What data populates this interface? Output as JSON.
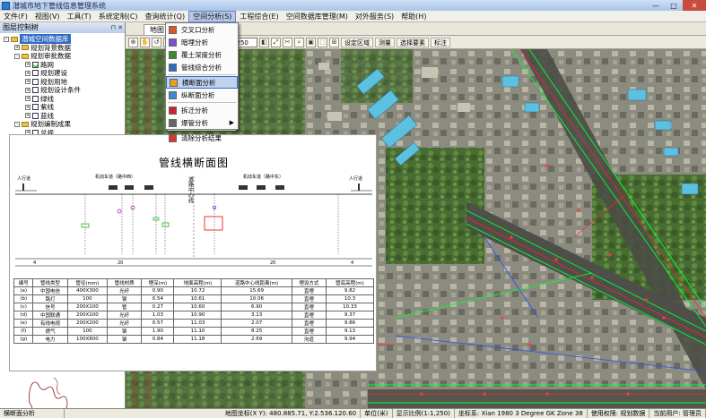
{
  "window": {
    "title": "潜城市地下管线信息管理系统",
    "min": "—",
    "max": "□",
    "close": "✕"
  },
  "menu": [
    "文件(F)",
    "视图(V)",
    "工具(T)",
    "系统定制(C)",
    "查询统计(Q)",
    "空间分析(S)",
    "工程综合(E)",
    "空间数据库管理(M)",
    "对外服务(S)",
    "帮助(H)"
  ],
  "menu_active_index": 5,
  "left_panel": {
    "title": "图层控制树",
    "tree": [
      {
        "indent": 0,
        "box": "-",
        "label": "潜城空间数据库",
        "selected": true,
        "kind": "folder"
      },
      {
        "indent": 1,
        "box": "+",
        "label": "规划背景数据",
        "kind": "folder"
      },
      {
        "indent": 1,
        "box": "-",
        "label": "规划审批数据",
        "kind": "folder"
      },
      {
        "indent": 2,
        "box": "+",
        "label": "路网",
        "checked": true
      },
      {
        "indent": 2,
        "box": "+",
        "label": "规划建设",
        "checked": false
      },
      {
        "indent": 2,
        "box": "+",
        "label": "规划用地",
        "checked": false
      },
      {
        "indent": 2,
        "box": "+",
        "label": "规划设计条件",
        "checked": false
      },
      {
        "indent": 2,
        "box": "+",
        "label": "绿线",
        "checked": false
      },
      {
        "indent": 2,
        "box": "+",
        "label": "紫线",
        "checked": false
      },
      {
        "indent": 2,
        "box": "+",
        "label": "蓝线",
        "checked": false
      },
      {
        "indent": 1,
        "box": "-",
        "label": "规划编制成果",
        "kind": "folder"
      },
      {
        "indent": 2,
        "box": "+",
        "label": "总规",
        "checked": false
      },
      {
        "indent": 2,
        "box": "+",
        "label": "控规",
        "checked": false
      }
    ]
  },
  "tab": {
    "label": "地图"
  },
  "toolbar": {
    "scale": "1:1,250",
    "buttons": [
      "设定区域",
      "测量",
      "选择要素",
      "标注"
    ]
  },
  "dropdown": {
    "items": [
      {
        "label": "交叉口分析"
      },
      {
        "label": "暗埋分析"
      },
      {
        "label": "覆土深度分析"
      },
      {
        "label": "管线综合分析"
      },
      {
        "sep": true
      },
      {
        "label": "横断面分析",
        "highlight": true
      },
      {
        "label": "纵断面分析"
      },
      {
        "sep": true
      },
      {
        "label": "拆迁分析"
      },
      {
        "label": "爆管分析",
        "submenu": true
      },
      {
        "sep": true
      },
      {
        "label": "清除分析结果"
      }
    ]
  },
  "cross_section": {
    "title": "管线横断面图",
    "labels": {
      "left_sidewalk": "人行道",
      "left_lane": "机动车道（路中西）",
      "center": "道路中心线",
      "right_lane": "机动车道（路中东）",
      "right_sidewalk": "人行道",
      "dim_left": "4",
      "dim_mid_left": "20",
      "dim_mid_right": "20",
      "dim_right": "4"
    },
    "pipe_tags": [
      "a",
      "b",
      "c",
      "d",
      "e",
      "f",
      "g"
    ],
    "table_headers": [
      "编号",
      "管线类型",
      "管径(mm)",
      "管线材质",
      "埋深(m)",
      "地面高程(m)",
      "道路中心线距离(m)",
      "埋设方式",
      "管底高程(m)"
    ],
    "table_rows": [
      [
        "(a)",
        "中国电信",
        "400X300",
        "光纤",
        "0.90",
        "10.72",
        "15.69",
        "直埋",
        "9.82"
      ],
      [
        "(b)",
        "路灯",
        "100",
        "钢",
        "0.54",
        "10.61",
        "10.06",
        "直埋",
        "10.3"
      ],
      [
        "(c)",
        "信号",
        "200X100",
        "管",
        "0.27",
        "10.60",
        "6.90",
        "直埋",
        "10.33"
      ],
      [
        "(d)",
        "中国联通",
        "200X100",
        "光纤",
        "1.03",
        "10.90",
        "3.13",
        "直埋",
        "9.37"
      ],
      [
        "(e)",
        "有线电视",
        "200X200",
        "光纤",
        "0.57",
        "11.03",
        "2.07",
        "直埋",
        "9.86"
      ],
      [
        "(f)",
        "燃气",
        "100",
        "钢",
        "1.90",
        "11.10",
        "8.25",
        "直埋",
        "9.13"
      ],
      [
        "(g)",
        "电力",
        "100X800",
        "钢",
        "0.84",
        "11.18",
        "2.69",
        "沟道",
        "9.94"
      ]
    ]
  },
  "status": {
    "left": "横断面分析",
    "coords": "地图坐标(X Y): 480.885.71, Y:2.536.120.60",
    "unit": "单位(米)",
    "scale": "显示比例(1:1,250)",
    "crs": "坐标系: Xian 1980 3 Degree GK Zone 38",
    "user1": "使用权限: 规划数据",
    "user2": "当前用户: 管理员"
  },
  "colors": {
    "accent": "#316ac5",
    "menu_active": "#b8c9e8"
  }
}
